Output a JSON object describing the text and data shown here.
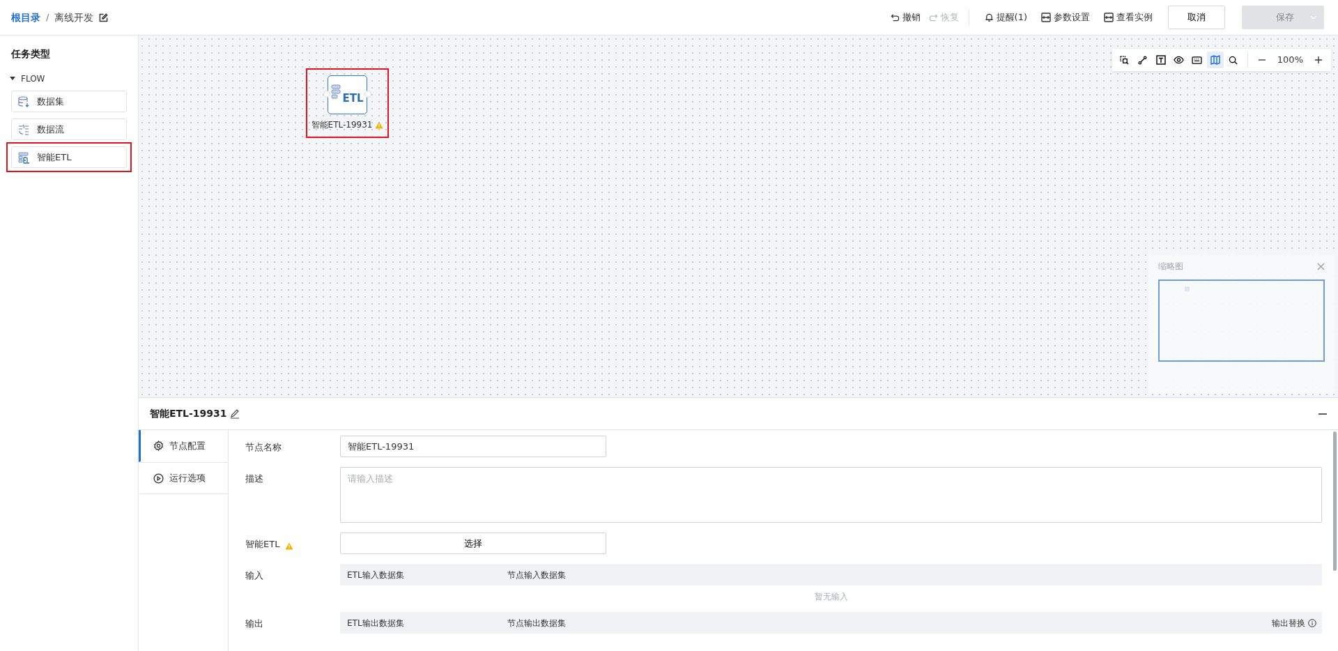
{
  "breadcrumb": {
    "items": [
      {
        "label": "根目录",
        "kind": "link"
      },
      {
        "label": "离线开发",
        "kind": "current"
      }
    ],
    "separator": "/"
  },
  "header_actions": [
    {
      "label": "撤销",
      "kind": "undo",
      "disabled": false
    },
    {
      "label": "恢复",
      "kind": "redo",
      "disabled": true
    },
    {
      "label": "提醒(1)",
      "kind": "bell",
      "disabled": false
    },
    {
      "label": "参数设置",
      "kind": "params",
      "disabled": false
    },
    {
      "label": "查看实例",
      "kind": "params",
      "disabled": false
    }
  ],
  "cancel_button": {
    "label": "取消"
  },
  "save_button": {
    "label": "保存",
    "disabled": true
  },
  "sidebar": {
    "title": "任务类型",
    "group": {
      "label": "FLOW",
      "expanded": true,
      "items": [
        {
          "label": "数据集",
          "kind": "dataset",
          "highlighted": false
        },
        {
          "label": "数据流",
          "kind": "flow",
          "highlighted": false
        },
        {
          "label": "智能ETL",
          "kind": "etl",
          "highlighted": true
        }
      ]
    }
  },
  "canvas": {
    "toolbar": {
      "tools": [
        {
          "kind": "select",
          "selected": false
        },
        {
          "kind": "connect",
          "selected": false
        },
        {
          "kind": "text",
          "selected": false
        },
        {
          "kind": "eye",
          "selected": false
        },
        {
          "kind": "keyboard",
          "selected": false
        },
        {
          "kind": "map",
          "selected": true
        },
        {
          "kind": "search",
          "selected": false
        }
      ],
      "zoom": "100%"
    },
    "nodes": [
      {
        "label": "智能ETL-19931",
        "icon_text": "ETL",
        "warning": true,
        "highlighted": true
      }
    ],
    "minimap": {
      "title": "缩略图"
    }
  },
  "panel": {
    "title": "智能ETL-19931",
    "tabs": [
      {
        "label": "节点配置",
        "kind": "gear",
        "selected": true
      },
      {
        "label": "运行选项",
        "kind": "play",
        "selected": false
      }
    ],
    "form": {
      "name": {
        "label": "节点名称",
        "value": "智能ETL-19931"
      },
      "description": {
        "label": "描述",
        "placeholder": "请输入描述"
      },
      "etl": {
        "label": "智能ETL",
        "warning": true,
        "button": "选择"
      },
      "input": {
        "label": "输入",
        "columns": [
          "ETL输入数据集",
          "节点输入数据集"
        ],
        "empty": "暂无输入"
      },
      "output": {
        "label": "输出",
        "columns": [
          "ETL输出数据集",
          "节点输出数据集"
        ],
        "extra": "输出替换"
      }
    }
  }
}
